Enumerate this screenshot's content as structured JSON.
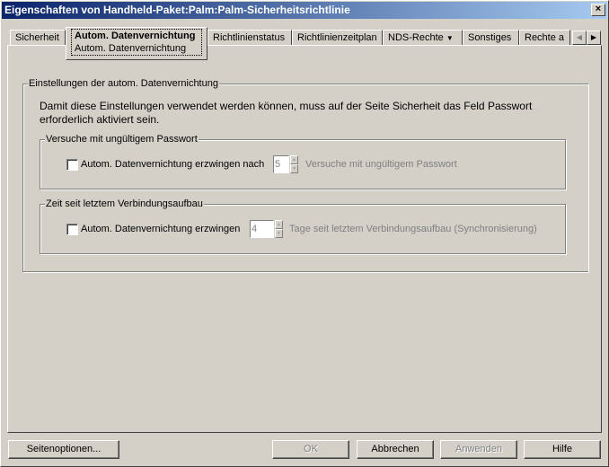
{
  "window": {
    "title": "Eigenschaften von Handheld-Paket:Palm:Palm-Sicherheitsrichtlinie",
    "close": "×"
  },
  "tabs": [
    {
      "label": "Sicherheit"
    },
    {
      "label": "Autom. Datenvernichtung",
      "sub": "Autom. Datenvernichtung"
    },
    {
      "label": "Richtlinienstatus"
    },
    {
      "label": "Richtlinienzeitplan"
    },
    {
      "label": "NDS-Rechte",
      "arrow": "▼"
    },
    {
      "label": "Sonstiges"
    },
    {
      "label": "Rechte a"
    }
  ],
  "tab_scroll": {
    "left": "◀",
    "right": "▶"
  },
  "settings": {
    "legend": "Einstellungen der autom. Datenvernichtung",
    "info": "Damit diese Einstellungen verwendet werden können, muss auf der Seite Sicherheit das Feld Passwort erforderlich aktiviert sein.",
    "group1": {
      "legend": "Versuche mit ungültigem Passwort",
      "checkbox": "Autom. Datenvernichtung erzwingen nach",
      "value": "5",
      "suffix": "Versuche mit ungültigem Passwort"
    },
    "group2": {
      "legend": "Zeit seit letztem Verbindungsaufbau",
      "checkbox": "Autom. Datenvernichtung erzwingen",
      "value": "4",
      "suffix": "Tage seit letztem Verbindungsaufbau (Synchronisierung)"
    }
  },
  "buttons": {
    "page_options": "Seitenoptionen...",
    "ok": "OK",
    "cancel": "Abbrechen",
    "apply": "Anwenden",
    "help": "Hilfe"
  }
}
